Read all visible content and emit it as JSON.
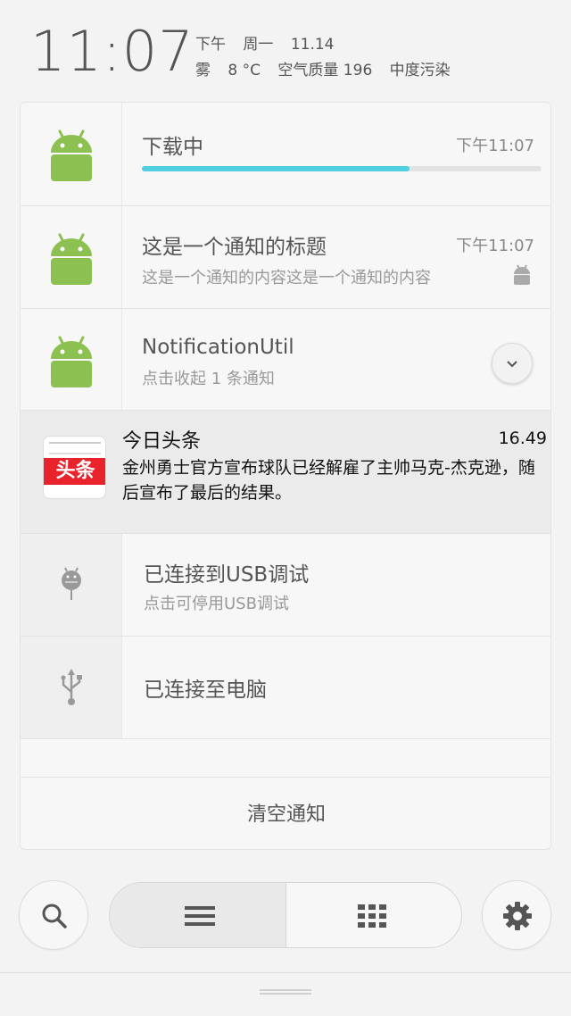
{
  "status": {
    "time": "11:07",
    "period": "下午",
    "weekday": "周一",
    "date": "11.14",
    "weather": "雾",
    "temperature": "8 °C",
    "air_quality": "空气质量 196",
    "pollution_level": "中度污染"
  },
  "notifications": [
    {
      "icon": "android-icon",
      "title": "下载中",
      "time": "下午11:07",
      "progress": 0.67
    },
    {
      "icon": "android-icon",
      "title": "这是一个通知的标题",
      "time": "下午11:07",
      "content": "这是一个通知的内容这是一个通知的内容",
      "small_icon": "android-icon"
    },
    {
      "icon": "android-icon",
      "title": "NotificationUtil",
      "subtitle": "点击收起 1 条通知",
      "action_icon": "chevron-down-icon"
    },
    {
      "icon": "toutiao-logo",
      "logo_text": "头条",
      "title": "今日头条",
      "time": "16.49",
      "content": "金州勇士官方宣布球队已经解雇了主帅马克-杰克逊，随后宣布了最后的结果。"
    },
    {
      "icon": "debug-android-icon",
      "title": "已连接到USB调试",
      "subtitle": "点击可停用USB调试"
    },
    {
      "icon": "usb-icon",
      "title": "已连接至电脑"
    }
  ],
  "clear_label": "清空通知",
  "bottom_bar": {
    "left_icon": "search-icon",
    "segment_left_icon": "list-icon",
    "segment_right_icon": "grid-icon",
    "right_icon": "gear-icon"
  },
  "colors": {
    "android_green": "#8cc152",
    "progress": "#4fcfe0",
    "toutiao_red": "#e8232b"
  }
}
